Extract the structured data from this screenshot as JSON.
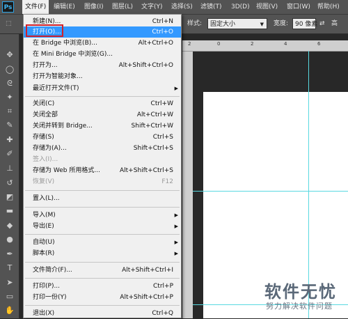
{
  "app": {
    "logo": "Ps"
  },
  "menubar": {
    "items": [
      {
        "label": "文件(F)"
      },
      {
        "label": "编辑(E)"
      },
      {
        "label": "图像(I)"
      },
      {
        "label": "图层(L)"
      },
      {
        "label": "文字(Y)"
      },
      {
        "label": "选择(S)"
      },
      {
        "label": "滤镜(T)"
      },
      {
        "label": "3D(D)"
      },
      {
        "label": "视图(V)"
      },
      {
        "label": "窗口(W)"
      },
      {
        "label": "帮助(H)"
      }
    ]
  },
  "options": {
    "style_label": "样式:",
    "style_value": "固定大小",
    "width_label": "宽度:",
    "width_value": "90 像素",
    "height_label": "高"
  },
  "ruler": {
    "ticks": [
      "2",
      "0",
      "2",
      "4",
      "6"
    ]
  },
  "file_menu": {
    "items": [
      {
        "label": "新建(N)...",
        "shortcut": "Ctrl+N"
      },
      {
        "label": "打开(O)...",
        "shortcut": "Ctrl+O"
      },
      {
        "label": "在 Bridge 中浏览(B)...",
        "shortcut": "Alt+Ctrl+O"
      },
      {
        "label": "在 Mini Bridge 中浏览(G)...",
        "shortcut": ""
      },
      {
        "label": "打开为...",
        "shortcut": "Alt+Shift+Ctrl+O"
      },
      {
        "label": "打开为智能对象...",
        "shortcut": ""
      },
      {
        "label": "最近打开文件(T)",
        "shortcut": ""
      },
      {
        "label": "关闭(C)",
        "shortcut": "Ctrl+W"
      },
      {
        "label": "关闭全部",
        "shortcut": "Alt+Ctrl+W"
      },
      {
        "label": "关闭并转到 Bridge...",
        "shortcut": "Shift+Ctrl+W"
      },
      {
        "label": "存储(S)",
        "shortcut": "Ctrl+S"
      },
      {
        "label": "存储为(A)...",
        "shortcut": "Shift+Ctrl+S"
      },
      {
        "label": "签入(I)...",
        "shortcut": ""
      },
      {
        "label": "存储为 Web 所用格式...",
        "shortcut": "Alt+Shift+Ctrl+S"
      },
      {
        "label": "恢复(V)",
        "shortcut": "F12"
      },
      {
        "label": "置入(L)...",
        "shortcut": ""
      },
      {
        "label": "导入(M)",
        "shortcut": ""
      },
      {
        "label": "导出(E)",
        "shortcut": ""
      },
      {
        "label": "自动(U)",
        "shortcut": ""
      },
      {
        "label": "脚本(R)",
        "shortcut": ""
      },
      {
        "label": "文件简介(F)...",
        "shortcut": "Alt+Shift+Ctrl+I"
      },
      {
        "label": "打印(P)...",
        "shortcut": "Ctrl+P"
      },
      {
        "label": "打印一份(Y)",
        "shortcut": "Alt+Shift+Ctrl+P"
      },
      {
        "label": "退出(X)",
        "shortcut": "Ctrl+Q"
      }
    ]
  },
  "watermark": {
    "title": "软件无忧",
    "subtitle": "努力解决软件问题"
  }
}
